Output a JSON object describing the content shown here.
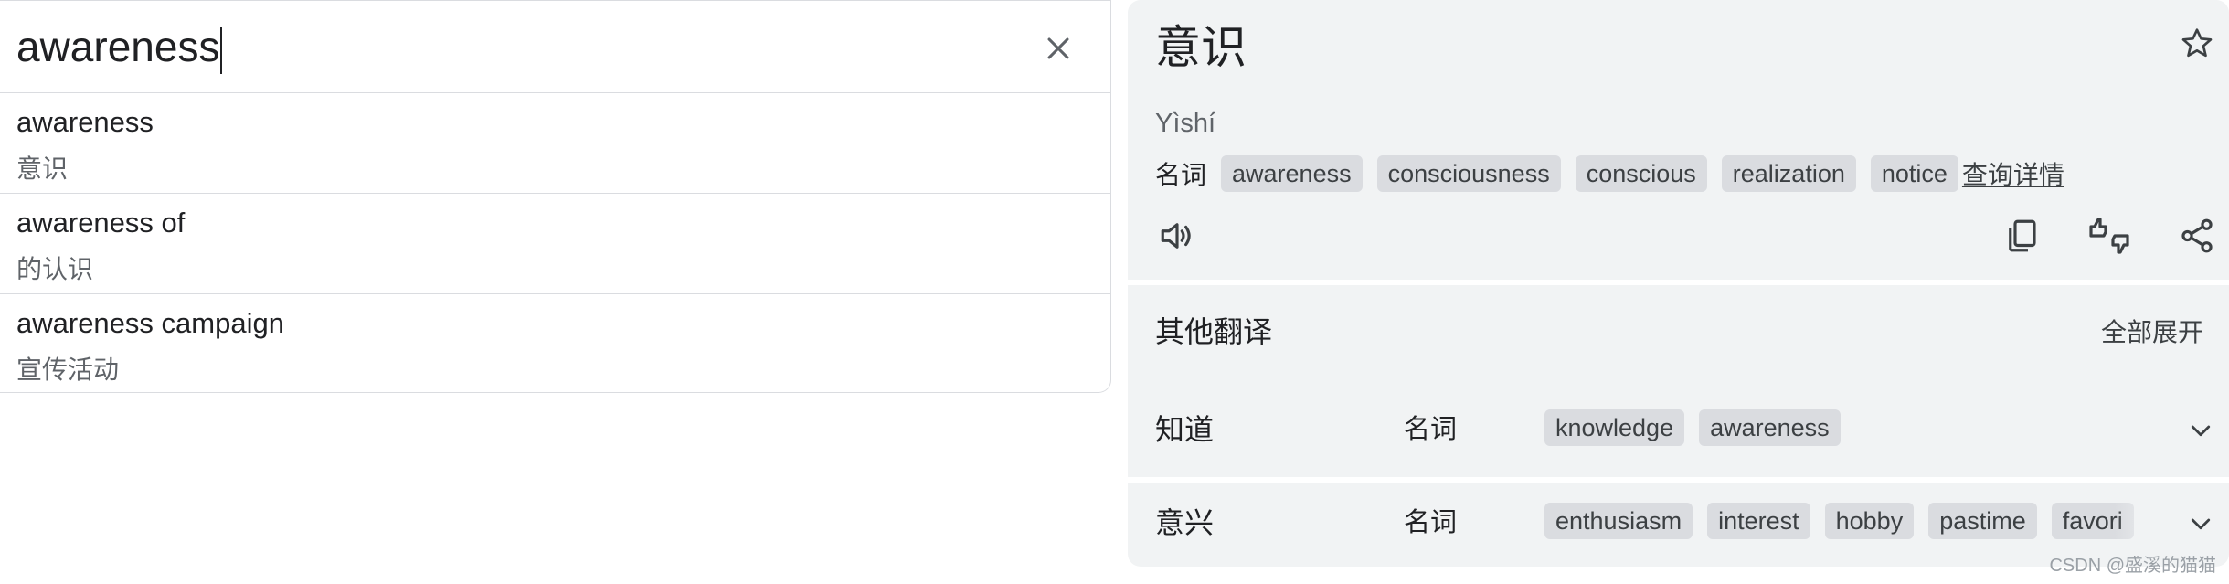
{
  "source": {
    "text": "awareness",
    "clear_icon": "close-icon"
  },
  "suggestions": [
    {
      "term": "awareness",
      "translation": "意识"
    },
    {
      "term": "awareness of",
      "translation": "的认识"
    },
    {
      "term": "awareness campaign",
      "translation": "宣传活动"
    }
  ],
  "result": {
    "translation": "意识",
    "romanization": "Yìshí",
    "pos": "名词",
    "chips": [
      "awareness",
      "consciousness",
      "conscious",
      "realization",
      "notice"
    ],
    "details_link": "查询详情",
    "icons": {
      "star": "star-icon",
      "speaker": "speaker-icon",
      "copy": "copy-icon",
      "feedback": "thumbs-rate-icon",
      "share": "share-icon"
    }
  },
  "other": {
    "title": "其他翻译",
    "expand_all": "全部展开",
    "rows": [
      {
        "word": "知道",
        "pos": "名词",
        "chips": [
          "knowledge",
          "awareness"
        ]
      },
      {
        "word": "意兴",
        "pos": "名词",
        "chips": [
          "enthusiasm",
          "interest",
          "hobby",
          "pastime",
          "favori"
        ]
      }
    ]
  },
  "watermark": "CSDN @盛溪的猫猫",
  "colors": {
    "panel_bg": "#f1f3f4",
    "chip_bg": "#dadce0",
    "text": "#202124",
    "secondary_text": "#5f6368"
  }
}
